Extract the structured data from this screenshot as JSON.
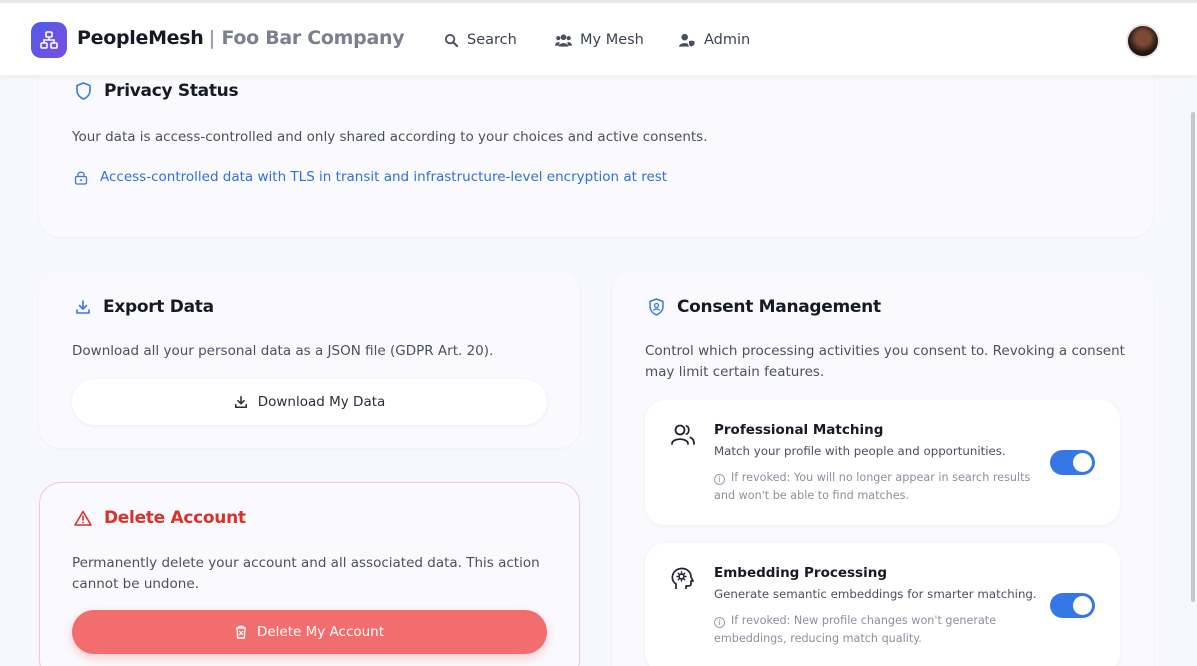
{
  "header": {
    "app_name": "PeopleMesh",
    "separator": "|",
    "company": "Foo Bar Company",
    "nav": [
      {
        "label": "Search",
        "icon": "search-icon"
      },
      {
        "label": "My Mesh",
        "icon": "users-icon"
      },
      {
        "label": "Admin",
        "icon": "user-shield-icon"
      }
    ]
  },
  "privacy": {
    "title": "Privacy Status",
    "description": "Your data is access-controlled and only shared according to your choices and active consents.",
    "encryption_note": "Access-controlled data with TLS in transit and infrastructure-level encryption at rest"
  },
  "export": {
    "title": "Export Data",
    "description": "Download all your personal data as a JSON file (GDPR Art. 20).",
    "button_label": "Download My Data"
  },
  "delete": {
    "title": "Delete Account",
    "description": "Permanently delete your account and all associated data. This action cannot be undone.",
    "button_label": "Delete My Account"
  },
  "consent": {
    "title": "Consent Management",
    "description": "Control which processing activities you consent to. Revoking a consent may limit certain features.",
    "items": [
      {
        "title": "Professional Matching",
        "description": "Match your profile with people and opportunities.",
        "warning": "If revoked: You will no longer appear in search results and won't be able to find matches.",
        "enabled": true
      },
      {
        "title": "Embedding Processing",
        "description": "Generate semantic embeddings for smarter matching.",
        "warning": "If revoked: New profile changes won't generate embeddings, reducing match quality.",
        "enabled": true
      }
    ]
  },
  "colors": {
    "accent": "#3577e6",
    "brand": "#5a55e8",
    "danger": "#f26d6d",
    "danger_text": "#d9322b",
    "link": "#2f6fe0"
  }
}
